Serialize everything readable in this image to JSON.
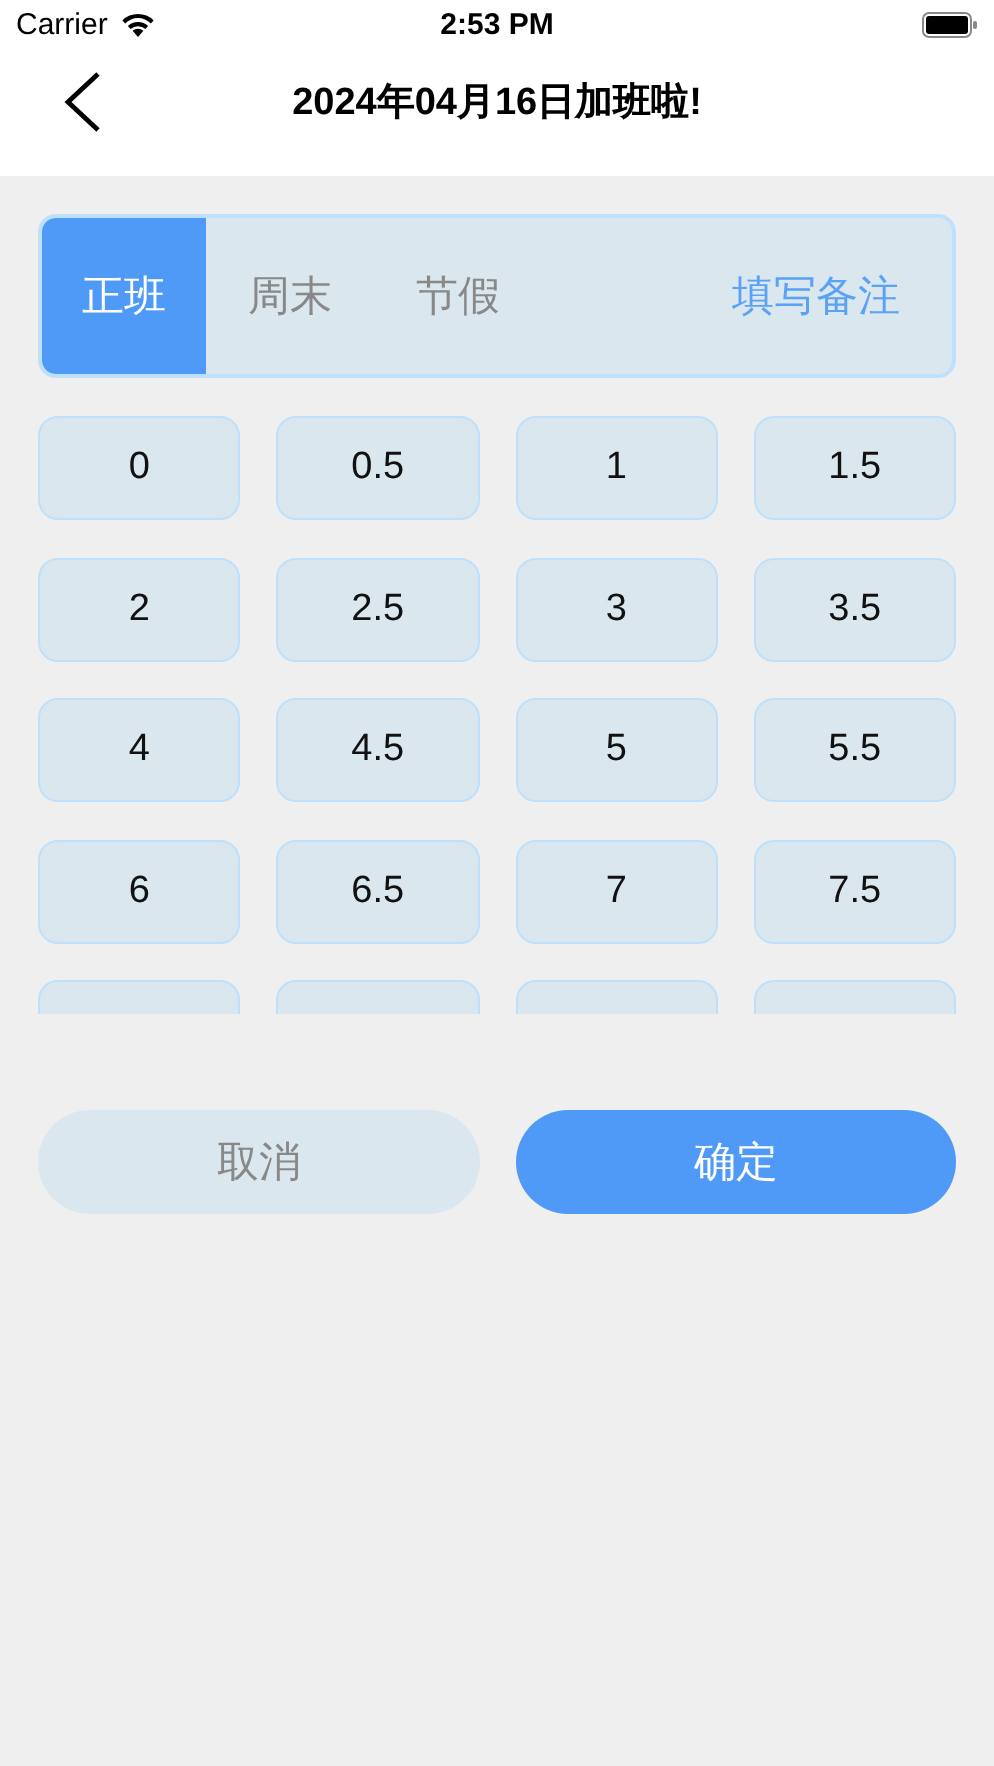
{
  "status_bar": {
    "carrier": "Carrier",
    "time": "2:53 PM"
  },
  "nav": {
    "title": "2024年04月16日加班啦!"
  },
  "tabs": [
    {
      "label": "正班",
      "selected": true
    },
    {
      "label": "周末",
      "selected": false
    },
    {
      "label": "节假",
      "selected": false
    }
  ],
  "note_button": "填写备注",
  "hours": [
    {
      "label": "0",
      "selected": false
    },
    {
      "label": "0.5",
      "selected": false
    },
    {
      "label": "1",
      "selected": false
    },
    {
      "label": "1.5",
      "selected": false
    },
    {
      "label": "2",
      "selected": false
    },
    {
      "label": "2.5",
      "selected": false
    },
    {
      "label": "3",
      "selected": false
    },
    {
      "label": "3.5",
      "selected": false
    },
    {
      "label": "4",
      "selected": false
    },
    {
      "label": "4.5",
      "selected": false
    },
    {
      "label": "5",
      "selected": false
    },
    {
      "label": "5.5",
      "selected": false
    },
    {
      "label": "6",
      "selected": false
    },
    {
      "label": "6.5",
      "selected": false
    },
    {
      "label": "7",
      "selected": false
    },
    {
      "label": "7.5",
      "selected": false
    }
  ],
  "buttons": {
    "cancel": "取消",
    "confirm": "确定"
  }
}
